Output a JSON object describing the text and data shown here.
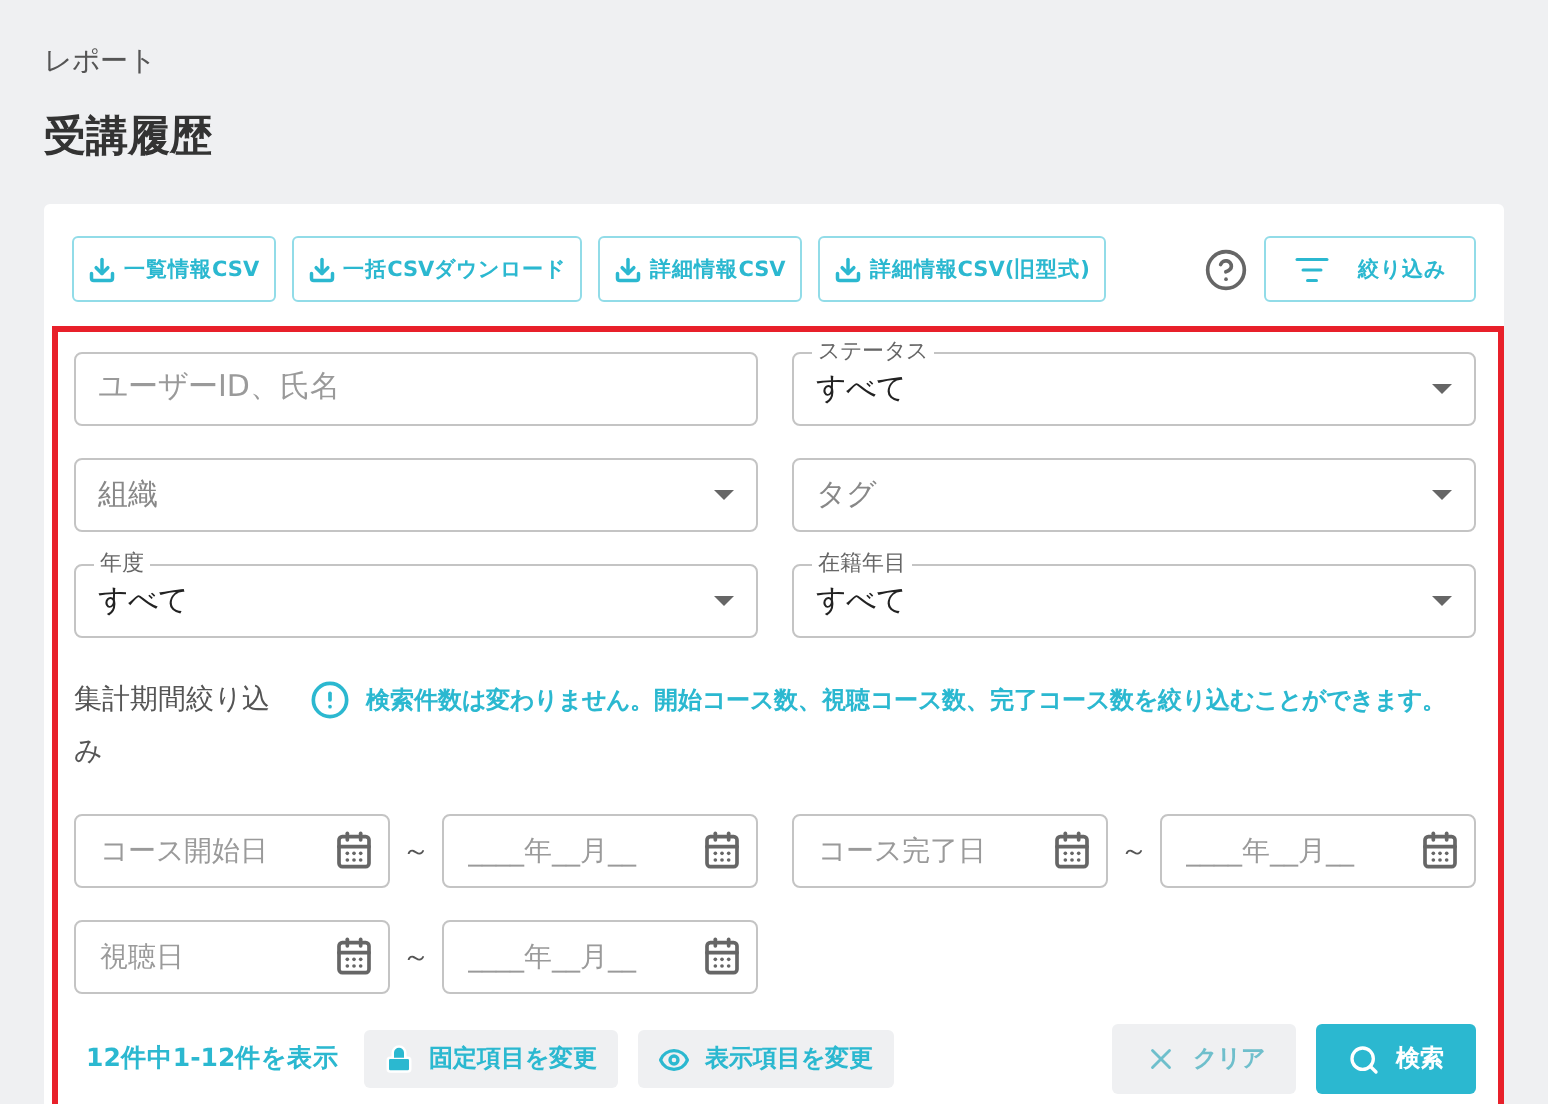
{
  "breadcrumb": "レポート",
  "title": "受講履歴",
  "toolbar": {
    "buttons": [
      {
        "label": "一覧情報CSV"
      },
      {
        "label": "一括CSVダウンロード"
      },
      {
        "label": "詳細情報CSV"
      },
      {
        "label": "詳細情報CSV(旧型式)"
      }
    ],
    "filter_button": {
      "label": "絞り込み"
    }
  },
  "filters": {
    "highlighted": true,
    "field_rows": [
      {
        "left": {
          "kind": "text",
          "placeholder": "ユーザーID、氏名"
        },
        "right": {
          "kind": "select",
          "value": "すべて",
          "label": "ステータス"
        }
      },
      {
        "left": {
          "kind": "select",
          "placeholder": "組織"
        },
        "right": {
          "kind": "select",
          "placeholder": "タグ"
        }
      },
      {
        "left": {
          "kind": "select",
          "value": "すべて",
          "label": "年度"
        },
        "right": {
          "kind": "select",
          "value": "すべて",
          "label": "在籍年目"
        }
      }
    ],
    "period": {
      "label": "集計期間絞り込み",
      "note": "検索件数は変わりません。開始コース数、視聴コース数、完了コース数を絞り込むことができます。"
    },
    "date_ranges": [
      {
        "from_placeholder": "コース開始日",
        "separator": "～",
        "to_placeholder": "____年__月__"
      },
      {
        "from_placeholder": "コース完了日",
        "separator": "～",
        "to_placeholder": "____年__月__"
      },
      {
        "from_placeholder": "視聴日",
        "separator": "～",
        "to_placeholder": "____年__月__"
      }
    ],
    "footer": {
      "count": "12件中1-12件を表示",
      "buttons": [
        {
          "kind": "lock",
          "label": "固定項目を変更"
        },
        {
          "kind": "eye",
          "label": "表示項目を変更"
        },
        {
          "kind": "clear",
          "label": "クリア"
        },
        {
          "kind": "search",
          "label": "検索"
        }
      ]
    }
  }
}
